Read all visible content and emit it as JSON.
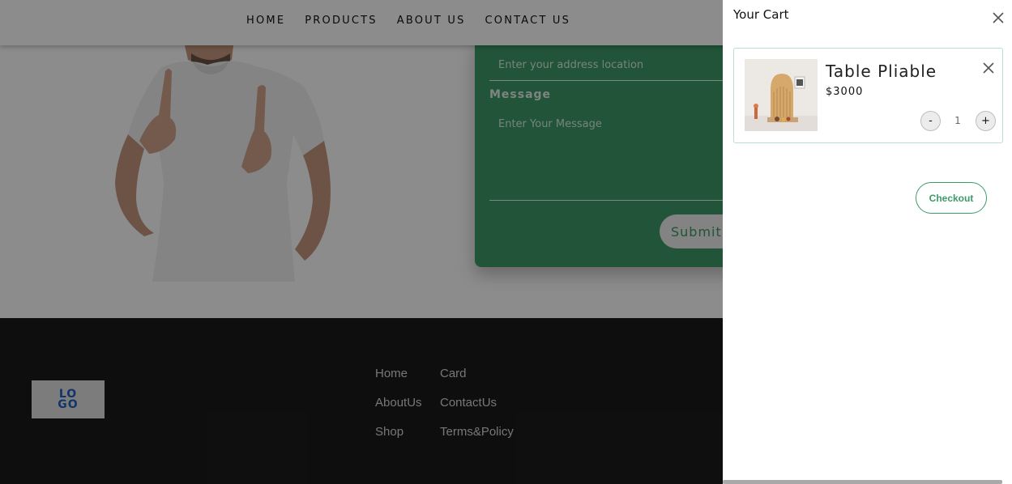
{
  "nav": {
    "items": [
      "HOME",
      "PRODUCTS",
      "ABOUT US",
      "CONTACT US"
    ]
  },
  "contact_form": {
    "address_placeholder": "Enter your address location",
    "message_label": "Message",
    "message_placeholder": "Enter Your Message",
    "submit_label": "Submit"
  },
  "footer": {
    "logo_text": "LOGO",
    "links": [
      "Home",
      "AboutUs",
      "Shop",
      "Card",
      "ContactUs",
      "Terms&Policy"
    ]
  },
  "cart": {
    "title": "Your Cart",
    "items": [
      {
        "name": "Table Pliable",
        "price": "$3000",
        "quantity": "1",
        "minus_label": "-",
        "plus_label": "+"
      }
    ],
    "checkout_label": "Checkout"
  },
  "colors": {
    "accent_green": "#3d9a68",
    "footer_bg": "#1b1b1b",
    "logo_blue": "#1f5fbf"
  }
}
